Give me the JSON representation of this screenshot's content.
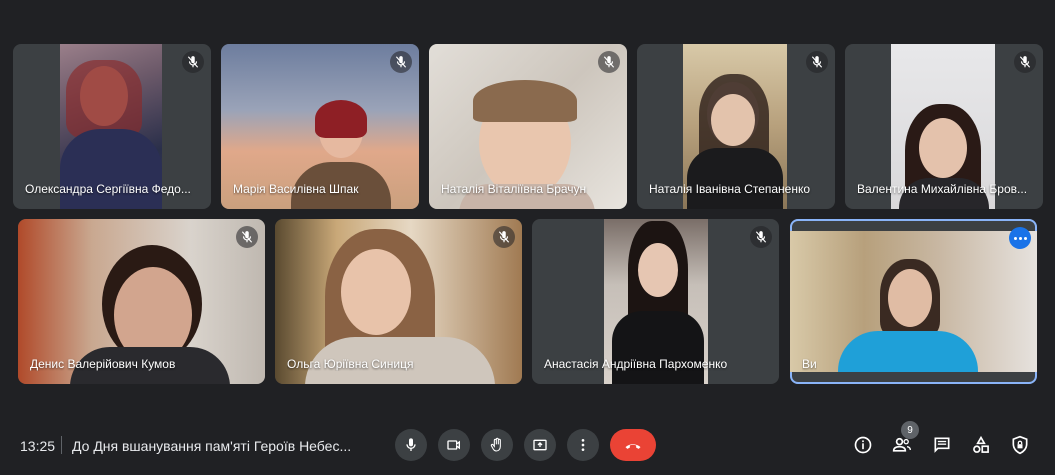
{
  "participants": [
    {
      "name": "Олександра Сергіївна Федо...",
      "muted": true
    },
    {
      "name": "Марія Василівна Шпак",
      "muted": true
    },
    {
      "name": "Наталія Віталіївна Брачун",
      "muted": true
    },
    {
      "name": "Наталія Іванівна Степаненко",
      "muted": true
    },
    {
      "name": "Валентина Михайлівна Бров...",
      "muted": true
    },
    {
      "name": "Денис Валерійович Кумов",
      "muted": true
    },
    {
      "name": "Ольга Юріївна Синиця",
      "muted": true
    },
    {
      "name": "Анастасія Андріївна Пархоменко",
      "muted": true
    },
    {
      "name": "Ви",
      "muted": false,
      "self": true
    }
  ],
  "bottom_bar": {
    "time": "13:25",
    "meeting_title": "До Дня вшанування пам'яті Героїв Небес...",
    "people_count": "9"
  },
  "icons": {
    "mic": "mic-icon",
    "camera": "camera-icon",
    "hand": "raise-hand-icon",
    "present": "present-screen-icon",
    "more": "more-options-icon",
    "end_call": "end-call-icon",
    "info": "info-icon",
    "people": "people-icon",
    "chat": "chat-icon",
    "activities": "activities-icon",
    "host_controls": "host-controls-icon"
  },
  "colors": {
    "background": "#202124",
    "end_call": "#ea4335",
    "self_highlight": "#8ab4f8"
  }
}
